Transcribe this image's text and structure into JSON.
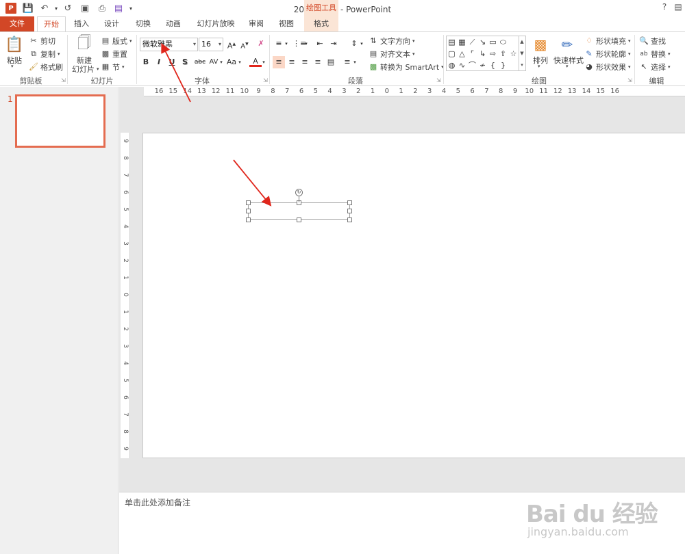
{
  "titlebar": {
    "title": "2013版PPT - PowerPoint",
    "context_tool_label": "绘图工具",
    "help": "?"
  },
  "tabs": [
    "文件",
    "开始",
    "插入",
    "设计",
    "切换",
    "动画",
    "幻灯片放映",
    "审阅",
    "视图",
    "格式"
  ],
  "ribbon": {
    "clipboard": {
      "paste": "粘贴",
      "cut": "剪切",
      "copy": "复制",
      "format_painter": "格式刷",
      "label": "剪贴板"
    },
    "slides": {
      "new_slide_line1": "新建",
      "new_slide_line2": "幻灯片",
      "layout": "版式",
      "reset": "重置",
      "section": "节",
      "label": "幻灯片"
    },
    "font": {
      "font_name": "微软雅黑",
      "font_size": "16",
      "bold": "B",
      "italic": "I",
      "underline": "U",
      "shadow": "S",
      "strike": "abc",
      "spacing": "AV",
      "case": "Aa",
      "color": "A",
      "label": "字体"
    },
    "paragraph": {
      "text_direction": "文字方向",
      "align_text": "对齐文本",
      "smartart": "转换为 SmartArt",
      "label": "段落"
    },
    "drawing": {
      "arrange": "排列",
      "quick_styles": "快速样式",
      "fill": "形状填充",
      "outline": "形状轮廓",
      "effects": "形状效果",
      "label": "绘图"
    },
    "editing": {
      "find": "查找",
      "replace": "替换",
      "select": "选择",
      "label": "编辑"
    }
  },
  "slide_panel": {
    "slide_number": "1"
  },
  "ruler": {
    "horizontal": [
      "16",
      "15",
      "14",
      "13",
      "12",
      "11",
      "10",
      "9",
      "8",
      "7",
      "6",
      "5",
      "4",
      "3",
      "2",
      "1",
      "0",
      "1",
      "2",
      "3",
      "4",
      "5",
      "6",
      "7",
      "8",
      "9",
      "10",
      "11",
      "12",
      "13",
      "14",
      "15",
      "16"
    ],
    "vertical": [
      "9",
      "8",
      "7",
      "6",
      "5",
      "4",
      "3",
      "2",
      "1",
      "0",
      "1",
      "2",
      "3",
      "4",
      "5",
      "6",
      "7",
      "8",
      "9"
    ]
  },
  "notes": {
    "placeholder": "单击此处添加备注"
  },
  "watermark": {
    "logo": "Bai du 经验",
    "url": "jingyan.baidu.com"
  },
  "colors": {
    "accent": "#d24726",
    "annotation_arrow": "#e0261c"
  }
}
